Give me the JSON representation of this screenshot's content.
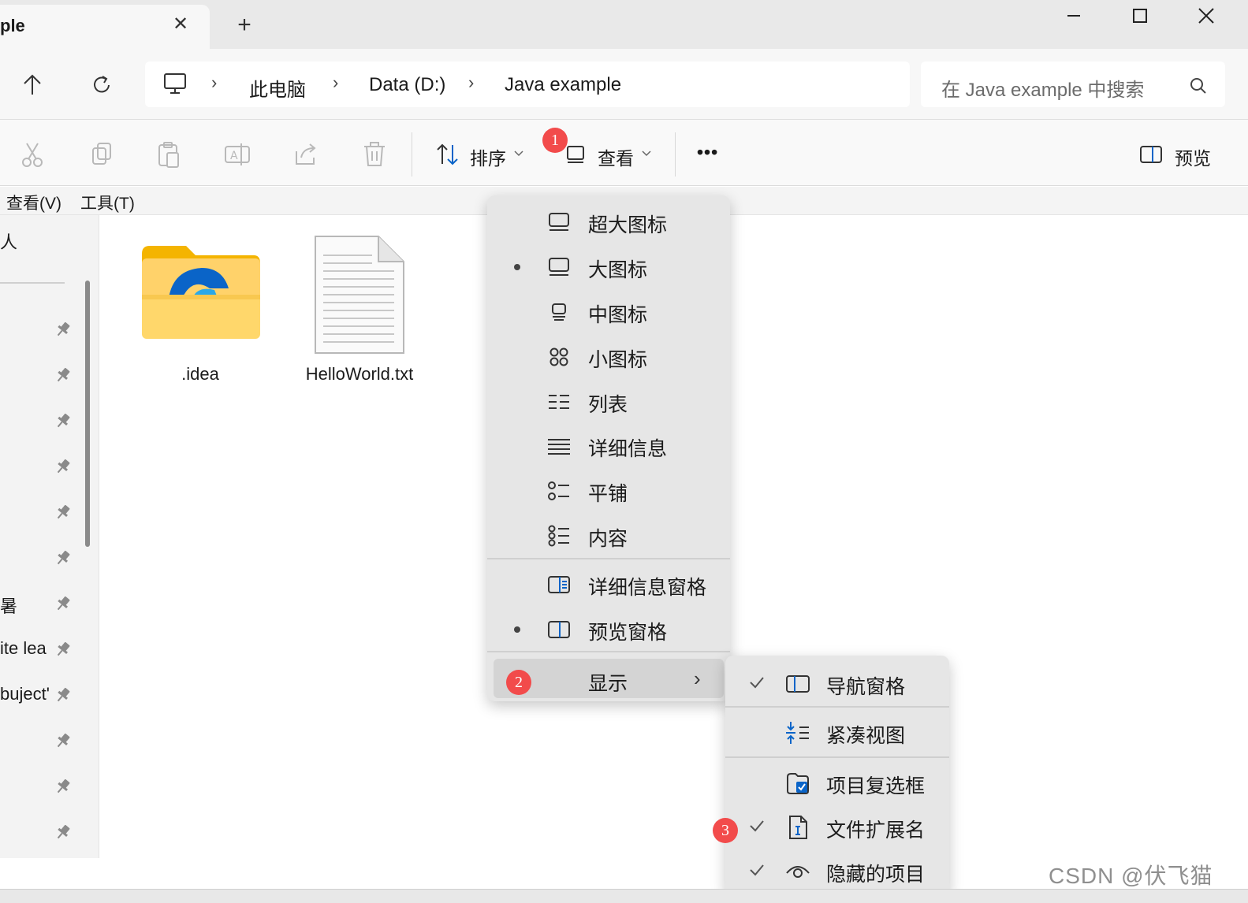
{
  "window": {
    "tab_title": "ple",
    "tab_close": "✕",
    "new_tab": "+",
    "minimize": "—",
    "maximize": "☐",
    "close": "✕"
  },
  "address": {
    "crumbs": [
      "此电脑",
      "Data (D:)",
      "Java example"
    ],
    "separator": "›",
    "search_placeholder": "在 Java example 中搜索"
  },
  "toolbar": {
    "sort_label": "排序",
    "view_label": "查看",
    "more_label": "•••",
    "preview_label": "预览"
  },
  "menubar": {
    "items": [
      "查看(V)",
      "工具(T)"
    ]
  },
  "sidebar": {
    "top_item": "人",
    "partial_items": [
      "暑",
      "ite  lea",
      "buject'"
    ]
  },
  "files": [
    {
      "name": ".idea",
      "type": "folder"
    },
    {
      "name": "HelloWorld.txt",
      "type": "text"
    }
  ],
  "view_menu": {
    "items": [
      {
        "label": "超大图标",
        "icon": "monitor-icon",
        "selected": false
      },
      {
        "label": "大图标",
        "icon": "monitor-icon",
        "selected": true
      },
      {
        "label": "中图标",
        "icon": "monitor-small-icon",
        "selected": false
      },
      {
        "label": "小图标",
        "icon": "grid-icon",
        "selected": false
      },
      {
        "label": "列表",
        "icon": "list-icon",
        "selected": false
      },
      {
        "label": "详细信息",
        "icon": "details-icon",
        "selected": false
      },
      {
        "label": "平铺",
        "icon": "tiles-icon",
        "selected": false
      },
      {
        "label": "内容",
        "icon": "content-icon",
        "selected": false
      },
      {
        "label": "详细信息窗格",
        "icon": "details-pane-icon",
        "selected": false
      },
      {
        "label": "预览窗格",
        "icon": "preview-pane-icon",
        "selected": true
      }
    ],
    "show_label": "显示",
    "show_arrow": "›"
  },
  "show_submenu": {
    "items": [
      {
        "label": "导航窗格",
        "icon": "nav-pane-icon",
        "checked": true
      },
      {
        "label": "紧凑视图",
        "icon": "compact-view-icon",
        "checked": false
      },
      {
        "label": "项目复选框",
        "icon": "checkbox-icon",
        "checked": false
      },
      {
        "label": "文件扩展名",
        "icon": "file-extension-icon",
        "checked": true
      },
      {
        "label": "隐藏的项目",
        "icon": "eye-icon",
        "checked": true
      }
    ]
  },
  "badges": [
    "1",
    "2",
    "3"
  ],
  "watermark": "CSDN @伏飞猫",
  "colors": {
    "accent": "#0a64c8",
    "badge": "#f24b4b",
    "menu_bg": "#e6e6e6"
  }
}
